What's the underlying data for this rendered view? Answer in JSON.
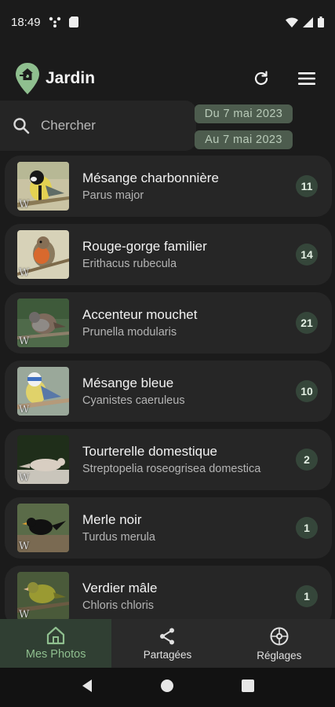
{
  "status_bar": {
    "time": "18:49",
    "icons": [
      "fan-icon",
      "sim-card-icon",
      "wifi-icon",
      "signal-icon",
      "battery-icon"
    ]
  },
  "header": {
    "title": "Jardin",
    "logo_icon": "location-pin-birdhouse-icon",
    "refresh_icon": "refresh-icon",
    "menu_icon": "hamburger-menu-icon"
  },
  "search": {
    "placeholder": "Chercher",
    "icon": "search-icon"
  },
  "dates": {
    "from": "Du 7 mai 2023",
    "to": "Au 7 mai 2023"
  },
  "species": [
    {
      "common": "Mésange charbonnière",
      "latin": "Parus major",
      "count": "11"
    },
    {
      "common": "Rouge-gorge familier",
      "latin": "Erithacus rubecula",
      "count": "14"
    },
    {
      "common": "Accenteur mouchet",
      "latin": "Prunella modularis",
      "count": "21"
    },
    {
      "common": "Mésange bleue",
      "latin": "Cyanistes caeruleus",
      "count": "10"
    },
    {
      "common": "Tourterelle domestique",
      "latin": "Streptopelia roseogrisea domestica",
      "count": "2"
    },
    {
      "common": "Merle noir",
      "latin": "Turdus merula",
      "count": "1"
    },
    {
      "common": "Verdier mâle",
      "latin": "Chloris chloris",
      "count": "1"
    }
  ],
  "wiki_badge": "W",
  "bottom_nav": [
    {
      "label": "Mes Photos",
      "icon": "home-icon",
      "active": true
    },
    {
      "label": "Partagées",
      "icon": "share-icon",
      "active": false
    },
    {
      "label": "Réglages",
      "icon": "settings-icon",
      "active": false
    }
  ],
  "colors": {
    "background": "#1b1b1b",
    "card": "#262626",
    "accent_green": "#8fbf8f",
    "count_badge": "#35463a",
    "date_chip": "#4d5c4e"
  }
}
